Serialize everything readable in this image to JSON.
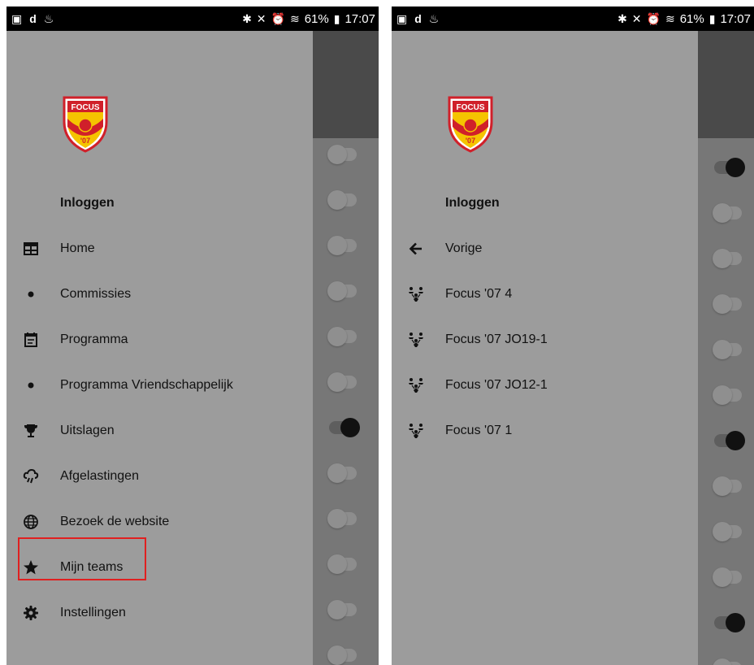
{
  "status_bar": {
    "battery": "61%",
    "time": "17:07"
  },
  "left_screen": {
    "login_label": "Inloggen",
    "menu": [
      {
        "label": "Home",
        "icon": "calendar-grid-icon"
      },
      {
        "label": "Commissies",
        "icon": "dot-icon"
      },
      {
        "label": "Programma",
        "icon": "calendar-list-icon"
      },
      {
        "label": "Programma Vriendschappelijk",
        "icon": "dot-icon"
      },
      {
        "label": "Uitslagen",
        "icon": "trophy-icon"
      },
      {
        "label": "Afgelastingen",
        "icon": "cloud-rain-icon"
      },
      {
        "label": "Bezoek de website",
        "icon": "globe-icon"
      },
      {
        "label": "Mijn teams",
        "icon": "star-icon",
        "highlighted": true
      },
      {
        "label": "Instellingen",
        "icon": "gear-icon"
      }
    ],
    "background_toggles": [
      false,
      false,
      false,
      false,
      false,
      false,
      true,
      false,
      false,
      false,
      false,
      false
    ]
  },
  "right_screen": {
    "login_label": "Inloggen",
    "back_label": "Vorige",
    "teams": [
      "Focus '07 4",
      "Focus '07 JO19-1",
      "Focus '07 JO12-1",
      "Focus '07 1"
    ],
    "background_toggles": [
      true,
      false,
      false,
      false,
      false,
      false,
      true,
      false,
      false,
      false,
      true,
      false
    ]
  },
  "logo": {
    "text_top": "FOCUS",
    "text_bottom": "'07"
  },
  "colors": {
    "highlight": "#e02020",
    "logo_red": "#d0202a",
    "logo_yellow": "#f5c400"
  }
}
